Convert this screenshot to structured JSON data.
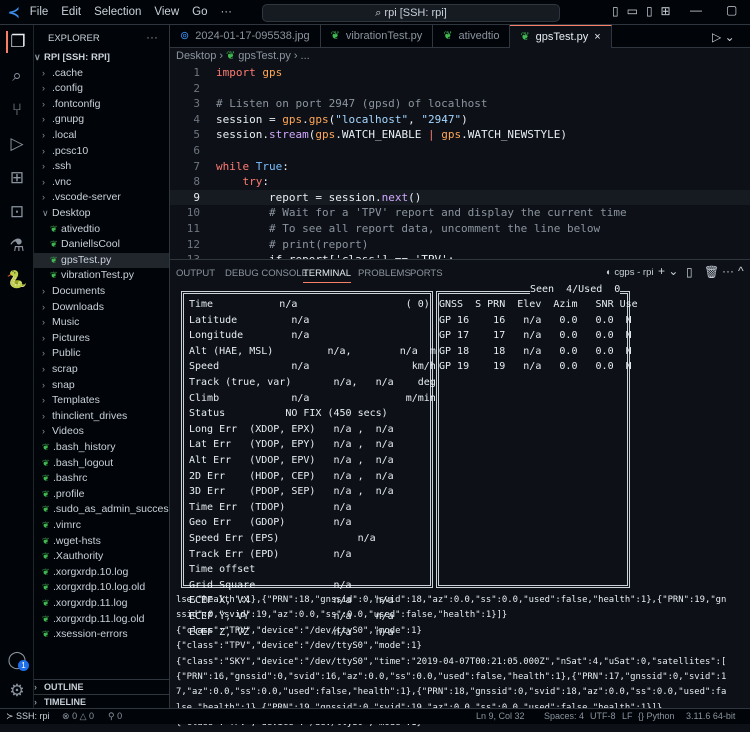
{
  "titlebar": {
    "menus": [
      "File",
      "Edit",
      "Selection",
      "View",
      "Go",
      "···"
    ],
    "search": "rpi [SSH: rpi]"
  },
  "sidebar": {
    "title": "EXPLORER",
    "more": "···",
    "root": "RPI [SSH: RPI]",
    "items": [
      {
        "label": ".cache",
        "type": "folder",
        "indent": 1
      },
      {
        "label": ".config",
        "type": "folder",
        "indent": 1
      },
      {
        "label": ".fontconfig",
        "type": "folder",
        "indent": 1
      },
      {
        "label": ".gnupg",
        "type": "folder",
        "indent": 1
      },
      {
        "label": ".local",
        "type": "folder",
        "indent": 1
      },
      {
        "label": ".pcsc10",
        "type": "folder",
        "indent": 1
      },
      {
        "label": ".ssh",
        "type": "folder",
        "indent": 1
      },
      {
        "label": ".vnc",
        "type": "folder",
        "indent": 1
      },
      {
        "label": ".vscode-server",
        "type": "folder",
        "indent": 1
      },
      {
        "label": "Desktop",
        "type": "folder-open",
        "indent": 1
      },
      {
        "label": "ativedtio",
        "type": "file",
        "indent": 2
      },
      {
        "label": "DaniellsCool",
        "type": "file",
        "indent": 2
      },
      {
        "label": "gpsTest.py",
        "type": "file",
        "indent": 2,
        "selected": true
      },
      {
        "label": "vibrationTest.py",
        "type": "file",
        "indent": 2
      },
      {
        "label": "Documents",
        "type": "folder",
        "indent": 1
      },
      {
        "label": "Downloads",
        "type": "folder",
        "indent": 1
      },
      {
        "label": "Music",
        "type": "folder",
        "indent": 1
      },
      {
        "label": "Pictures",
        "type": "folder",
        "indent": 1
      },
      {
        "label": "Public",
        "type": "folder",
        "indent": 1
      },
      {
        "label": "scrap",
        "type": "folder",
        "indent": 1
      },
      {
        "label": "snap",
        "type": "folder",
        "indent": 1
      },
      {
        "label": "Templates",
        "type": "folder",
        "indent": 1
      },
      {
        "label": "thinclient_drives",
        "type": "folder",
        "indent": 1
      },
      {
        "label": "Videos",
        "type": "folder",
        "indent": 1
      },
      {
        "label": ".bash_history",
        "type": "file",
        "indent": 1
      },
      {
        "label": ".bash_logout",
        "type": "file",
        "indent": 1
      },
      {
        "label": ".bashrc",
        "type": "file",
        "indent": 1
      },
      {
        "label": ".profile",
        "type": "file",
        "indent": 1
      },
      {
        "label": ".sudo_as_admin_succes...",
        "type": "file",
        "indent": 1
      },
      {
        "label": ".vimrc",
        "type": "file",
        "indent": 1
      },
      {
        "label": ".wget-hsts",
        "type": "file",
        "indent": 1
      },
      {
        "label": ".Xauthority",
        "type": "file",
        "indent": 1
      },
      {
        "label": ".xorgxrdp.10.log",
        "type": "file",
        "indent": 1
      },
      {
        "label": ".xorgxrdp.10.log.old",
        "type": "file",
        "indent": 1
      },
      {
        "label": ".xorgxrdp.11.log",
        "type": "file",
        "indent": 1
      },
      {
        "label": ".xorgxrdp.11.log.old",
        "type": "file",
        "indent": 1
      },
      {
        "label": ".xsession-errors",
        "type": "file",
        "indent": 1
      }
    ],
    "outline": "OUTLINE",
    "timeline": "TIMELINE",
    "accounts_badge": "1"
  },
  "tabs": [
    {
      "label": "2024-01-17-095538.jpg",
      "icon": "image-icon"
    },
    {
      "label": "vibrationTest.py",
      "icon": "python-icon"
    },
    {
      "label": "ativedtio",
      "icon": "python-icon"
    },
    {
      "label": "gpsTest.py",
      "icon": "python-icon",
      "active": true,
      "close": "×"
    }
  ],
  "breadcrumb": [
    "Desktop",
    "gpsTest.py",
    "..."
  ],
  "code": [
    [
      [
        "import ",
        "kw"
      ],
      [
        "gps",
        "mod"
      ]
    ],
    [],
    [
      [
        "# Listen on port 2947 (gpsd) of localhost",
        "cm"
      ]
    ],
    [
      [
        "session = ",
        "tx"
      ],
      [
        "gps",
        "mod"
      ],
      [
        ".",
        "tx"
      ],
      [
        "gps",
        "mod"
      ],
      [
        "(",
        "tx"
      ],
      [
        "\"localhost\"",
        "str"
      ],
      [
        ", ",
        "tx"
      ],
      [
        "\"2947\"",
        "str"
      ],
      [
        ")",
        "tx"
      ]
    ],
    [
      [
        "session.",
        "tx"
      ],
      [
        "stream",
        "fn"
      ],
      [
        "(",
        "tx"
      ],
      [
        "gps",
        "mod"
      ],
      [
        ".WATCH_ENABLE ",
        "tx"
      ],
      [
        "|",
        "kw"
      ],
      [
        " ",
        "tx"
      ],
      [
        "gps",
        "mod"
      ],
      [
        ".WATCH_NEWSTYLE)",
        "tx"
      ]
    ],
    [],
    [
      [
        "while ",
        "kw"
      ],
      [
        "True",
        "bi"
      ],
      [
        ":",
        "tx"
      ]
    ],
    [
      [
        "    try",
        "kw"
      ],
      [
        ":",
        "tx"
      ]
    ],
    [
      [
        "        report = session.",
        "tx"
      ],
      [
        "next",
        "fn"
      ],
      [
        "()",
        "tx"
      ]
    ],
    [
      [
        "        # Wait for a 'TPV' report and display the current time",
        "cm"
      ]
    ],
    [
      [
        "        # To see all report data, uncomment the line below",
        "cm"
      ]
    ],
    [
      [
        "        # print(report)",
        "cm"
      ]
    ],
    [
      [
        "        if report['class'] == 'TPV':",
        "tx"
      ]
    ]
  ],
  "panel": {
    "tabs": [
      "OUTPUT",
      "DEBUG CONSOLE",
      "TERMINAL",
      "PROBLEMS",
      "PORTS"
    ],
    "active": "TERMINAL",
    "terminal_name": "cgps - rpi"
  },
  "terminal": {
    "left": [
      "Time           n/a                  ( 0)",
      "Latitude         n/a",
      "Longitude        n/a",
      "Alt (HAE, MSL)         n/a,        n/a  m",
      "Speed            n/a                 km/h",
      "Track (true, var)       n/a,   n/a    deg",
      "Climb            n/a                m/min",
      "Status          NO FIX (450 secs)",
      "Long Err  (XDOP, EPX)   n/a ,  n/a",
      "Lat Err   (YDOP, EPY)   n/a ,  n/a",
      "Alt Err   (VDOP, EPV)   n/a ,  n/a",
      "2D Err    (HDOP, CEP)   n/a ,  n/a",
      "3D Err    (PDOP, SEP)   n/a ,  n/a",
      "Time Err  (TDOP)        n/a",
      "Geo Err   (GDOP)        n/a",
      "Speed Err (EPS)             n/a",
      "Track Err (EPD)         n/a",
      "Time offset",
      "Grid Square             n/a",
      "ECEF X, VX              n/a    n/a",
      "ECEF Y, VY              n/a    n/a",
      "ECEF Z, VZ              n/a    n/a"
    ],
    "right_title": "Seen  4/Used  0",
    "right": [
      "GNSS  S PRN  Elev  Azim   SNR Use",
      "GP 16    16   n/a   0.0   0.0  N",
      "GP 17    17   n/a   0.0   0.0  N",
      "GP 18    18   n/a   0.0   0.0  N",
      "GP 19    19   n/a   0.0   0.0  N"
    ],
    "log": [
      "lse,\"health\":1},{\"PRN\":18,\"gnssid\":0,\"svid\":18,\"az\":0.0,\"ss\":0.0,\"used\":false,\"health\":1},{\"PRN\":19,\"gn",
      "ssid\":0,\"svid\":19,\"az\":0.0,\"ss\":0.0,\"used\":false,\"health\":1}]}",
      "{\"class\":\"TPV\",\"device\":\"/dev/ttyS0\",\"mode\":1}",
      "{\"class\":\"TPV\",\"device\":\"/dev/ttyS0\",\"mode\":1}",
      "{\"class\":\"SKY\",\"device\":\"/dev/ttyS0\",\"time\":\"2019-04-07T00:21:05.000Z\",\"nSat\":4,\"uSat\":0,\"satellites\":[",
      "{\"PRN\":16,\"gnssid\":0,\"svid\":16,\"az\":0.0,\"ss\":0.0,\"used\":false,\"health\":1},{\"PRN\":17,\"gnssid\":0,\"svid\":1",
      "7,\"az\":0.0,\"ss\":0.0,\"used\":false,\"health\":1},{\"PRN\":18,\"gnssid\":0,\"svid\":18,\"az\":0.0,\"ss\":0.0,\"used\":fa",
      "lse,\"health\":1},{\"PRN\":19,\"gnssid\":0,\"svid\":19,\"az\":0.0,\"ss\":0.0,\"used\":false,\"health\":1}]}",
      "{\"class\":\"TPV\",\"device\":\"/dev/ttyS0\",\"mode\":1}"
    ]
  },
  "status": {
    "remote": "SSH: rpi",
    "errors": "0",
    "warnings": "0",
    "ports": "0",
    "position": "Ln 9, Col 32",
    "spaces": "Spaces: 4",
    "encoding": "UTF-8",
    "eol": "LF",
    "language": "Python",
    "interpreter": "3.11.6 64-bit"
  },
  "colors": {
    "accent": "#f78166",
    "badge": "#1f6feb",
    "background": "#0d1117"
  }
}
